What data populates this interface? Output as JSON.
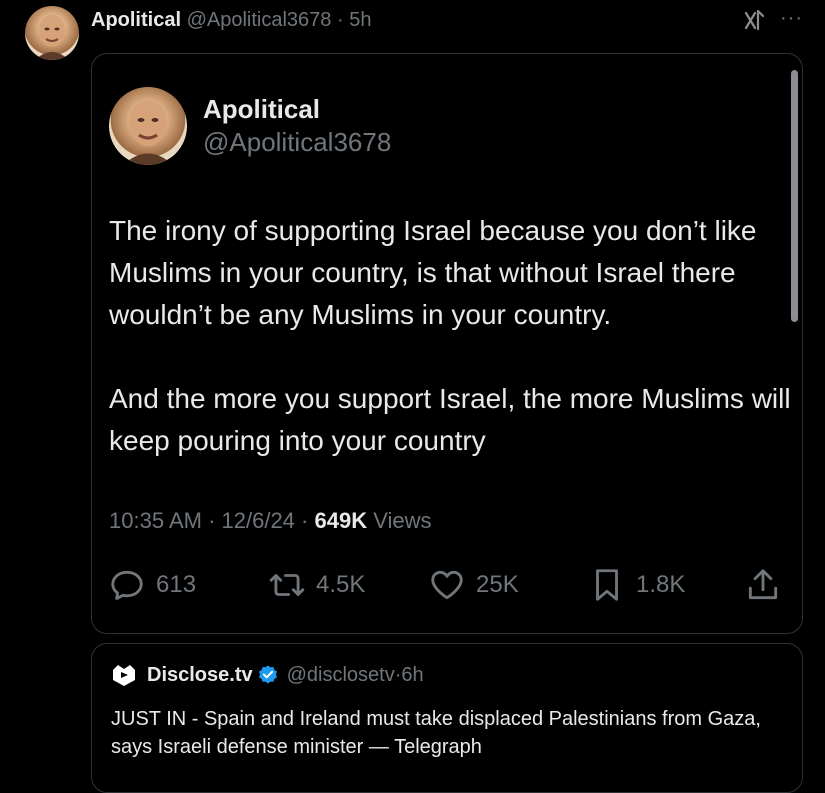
{
  "outer": {
    "name": "Apolitical",
    "handle": "@Apolitical3678",
    "separator": " · ",
    "time": "5h",
    "more_label": "···"
  },
  "quoted": {
    "name": "Apolitical",
    "handle": "@Apolitical3678",
    "paragraphs": [
      "The irony of supporting Israel because you don’t like Muslims in your country, is that without Israel there wouldn’t be any Muslims in your country.",
      "And the more you support Israel, the more Muslims will keep pouring into your country"
    ],
    "meta": {
      "time": "10:35 AM",
      "dot": " · ",
      "date": "12/6/24",
      "views_count": "649K",
      "views_label": " Views"
    },
    "actions": {
      "reply_count": "613",
      "retweet_count": "4.5K",
      "like_count": "25K",
      "bookmark_count": "1.8K"
    }
  },
  "embedded": {
    "name": "Disclose.tv",
    "handle": "@disclosetv",
    "separator": " · ",
    "time": "6h",
    "text": "JUST IN - Spain and Ireland must take displaced Palestinians from Gaza, says Israeli defense minister — Telegraph"
  },
  "colors": {
    "background": "#000000",
    "text": "#e7e9ea",
    "muted": "#71767b",
    "border": "#2f3336",
    "verified": "#1d9bf0"
  },
  "icons": {
    "grok": "grok-icon",
    "more": "more-icon",
    "reply": "reply-icon",
    "retweet": "retweet-icon",
    "like": "heart-icon",
    "bookmark": "bookmark-icon",
    "share": "share-icon",
    "verified": "verified-badge-icon"
  }
}
